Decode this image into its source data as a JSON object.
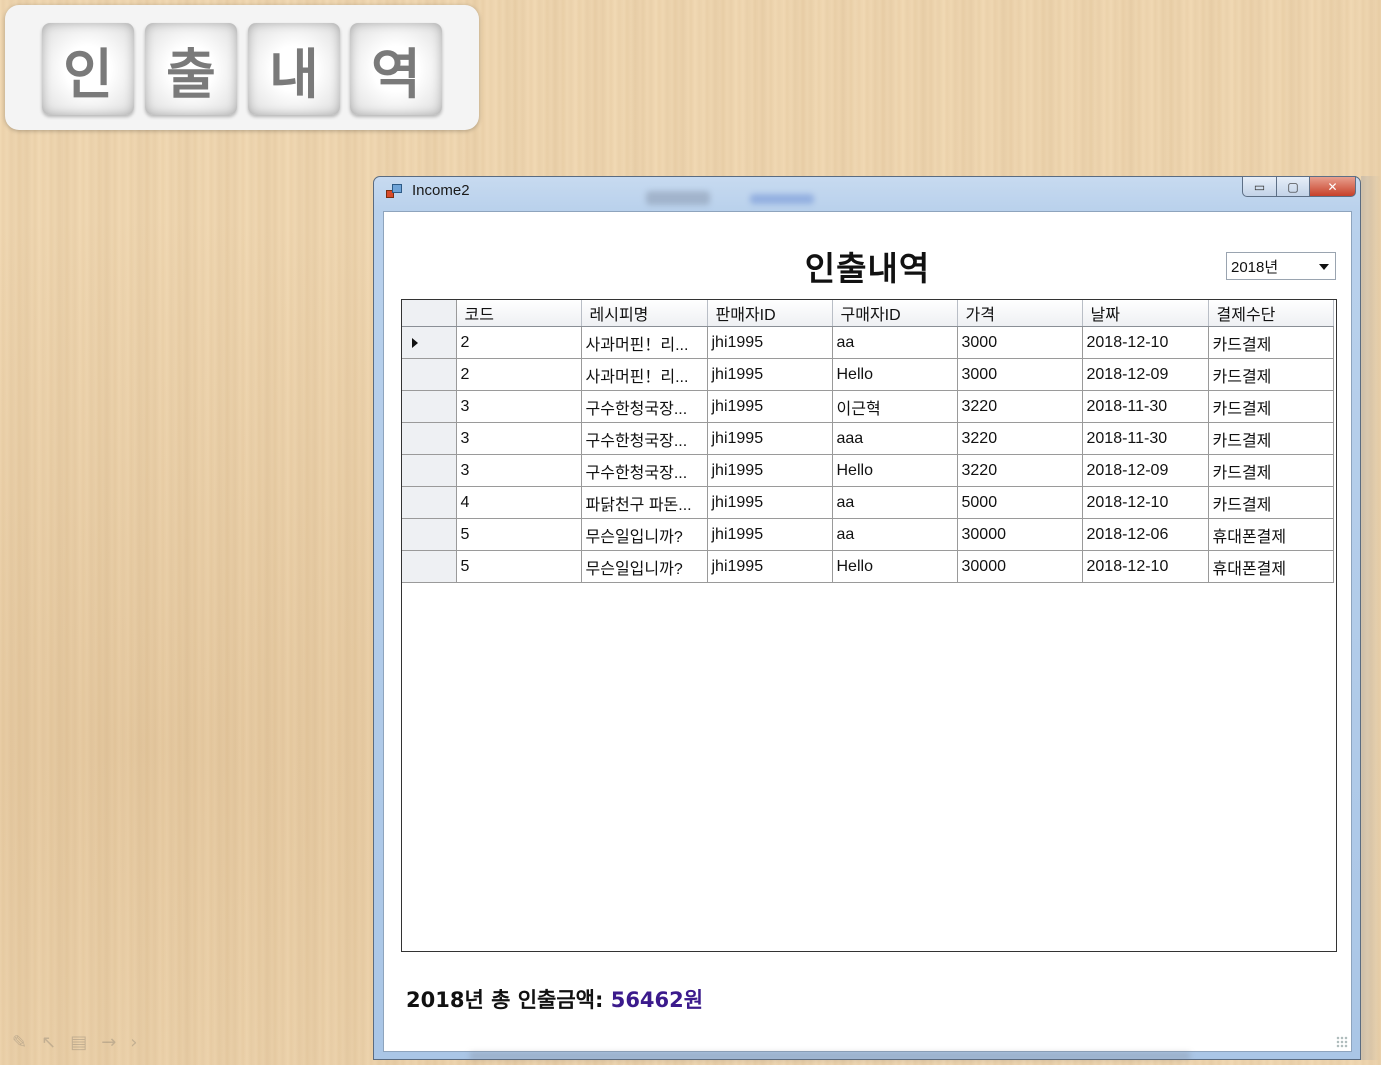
{
  "slide": {
    "title_tiles": [
      "인",
      "출",
      "내",
      "역"
    ],
    "controls": [
      "✎",
      "↖",
      "▤",
      "→",
      "›"
    ]
  },
  "window": {
    "title": "Income2",
    "buttons": {
      "minimize": "▭",
      "maximize": "▢",
      "close": "✕"
    }
  },
  "form": {
    "title": "인출내역",
    "year_select": {
      "selected": "2018년"
    }
  },
  "grid": {
    "columns": [
      "코드",
      "레시피명",
      "판매자ID",
      "구매자ID",
      "가격",
      "날짜",
      "결제수단"
    ],
    "rows": [
      [
        "2",
        "사과머핀！리...",
        "jhi1995",
        "aa",
        "3000",
        "2018-12-10",
        "카드결제"
      ],
      [
        "2",
        "사과머핀！리...",
        "jhi1995",
        "Hello",
        "3000",
        "2018-12-09",
        "카드결제"
      ],
      [
        "3",
        "구수한청국장...",
        "jhi1995",
        "이근혁",
        "3220",
        "2018-11-30",
        "카드결제"
      ],
      [
        "3",
        "구수한청국장...",
        "jhi1995",
        "aaa",
        "3220",
        "2018-11-30",
        "카드결제"
      ],
      [
        "3",
        "구수한청국장...",
        "jhi1995",
        "Hello",
        "3220",
        "2018-12-09",
        "카드결제"
      ],
      [
        "4",
        "파닭천구 파돈...",
        "jhi1995",
        "aa",
        "5000",
        "2018-12-10",
        "카드결제"
      ],
      [
        "5",
        "무슨일입니까?",
        "jhi1995",
        "aa",
        "30000",
        "2018-12-06",
        "휴대폰결제"
      ],
      [
        "5",
        "무슨일입니까?",
        "jhi1995",
        "Hello",
        "30000",
        "2018-12-10",
        "휴대폰결제"
      ]
    ],
    "current_row": 0
  },
  "footer": {
    "label": "2018년 총 인출금액: ",
    "amount": "56462원"
  },
  "colors": {
    "amount": "#3b1a8c",
    "close_button": "#c7402a"
  }
}
